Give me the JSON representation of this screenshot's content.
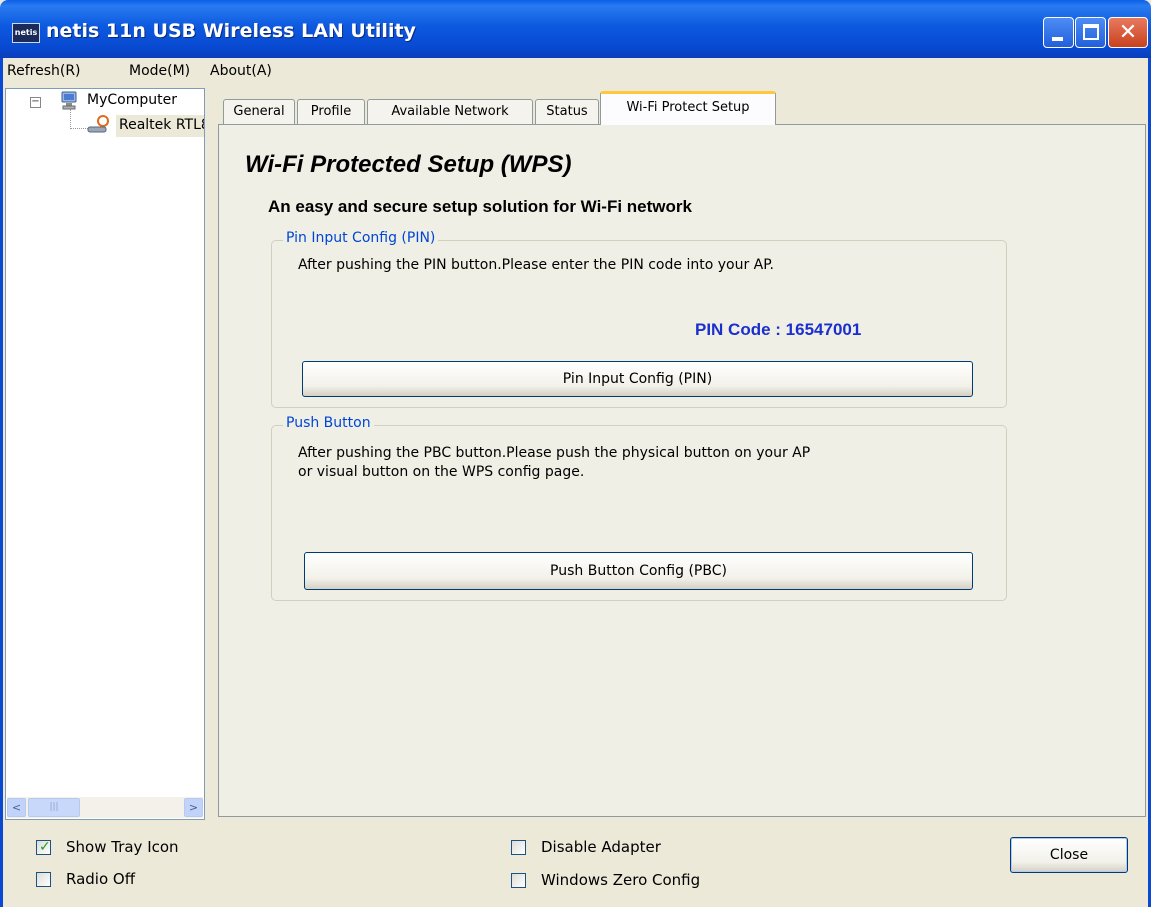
{
  "window": {
    "title": "netis 11n USB Wireless LAN Utility",
    "app_icon_text": "netis",
    "close_glyph": "✕"
  },
  "menu": {
    "items": [
      "Refresh(R)",
      "Mode(M)",
      "About(A)"
    ]
  },
  "tree": {
    "root_label": "MyComputer",
    "child_label": "Realtek RTL8",
    "toggle": "−",
    "scroll_left": "<",
    "scroll_right": ">",
    "scroll_thumb": "|||"
  },
  "tabs": [
    "General",
    "Profile",
    "Available Network",
    "Status",
    "Wi-Fi Protect Setup"
  ],
  "wps": {
    "title": "Wi-Fi Protected Setup (WPS)",
    "subtitle": "An easy and secure setup solution for Wi-Fi network",
    "pin_group": {
      "legend": "Pin Input Config (PIN)",
      "desc": "After pushing the PIN button.Please enter the PIN code into your AP.",
      "pin_code": "PIN Code :  16547001",
      "button": "Pin Input Config (PIN)"
    },
    "pbc_group": {
      "legend": "Push Button",
      "desc_line1": "After pushing the PBC button.Please push the physical button on your AP",
      "desc_line2": "or visual button on the WPS config page.",
      "button": "Push Button Config (PBC)"
    }
  },
  "bottom": {
    "show_tray_icon": {
      "label": "Show Tray Icon",
      "checked": true
    },
    "radio_off": {
      "label": "Radio Off",
      "checked": false
    },
    "disable_adapter": {
      "label": "Disable Adapter",
      "checked": false
    },
    "windows_zero_config": {
      "label": "Windows Zero Config",
      "checked": false
    },
    "close_button": "Close",
    "check_glyph": "✓"
  },
  "colors": {
    "titlebar": "#0C59E0",
    "pin_code": "#1B2FCF",
    "group_legend": "#0046D5",
    "active_tab_accent": "#FFC83C"
  }
}
